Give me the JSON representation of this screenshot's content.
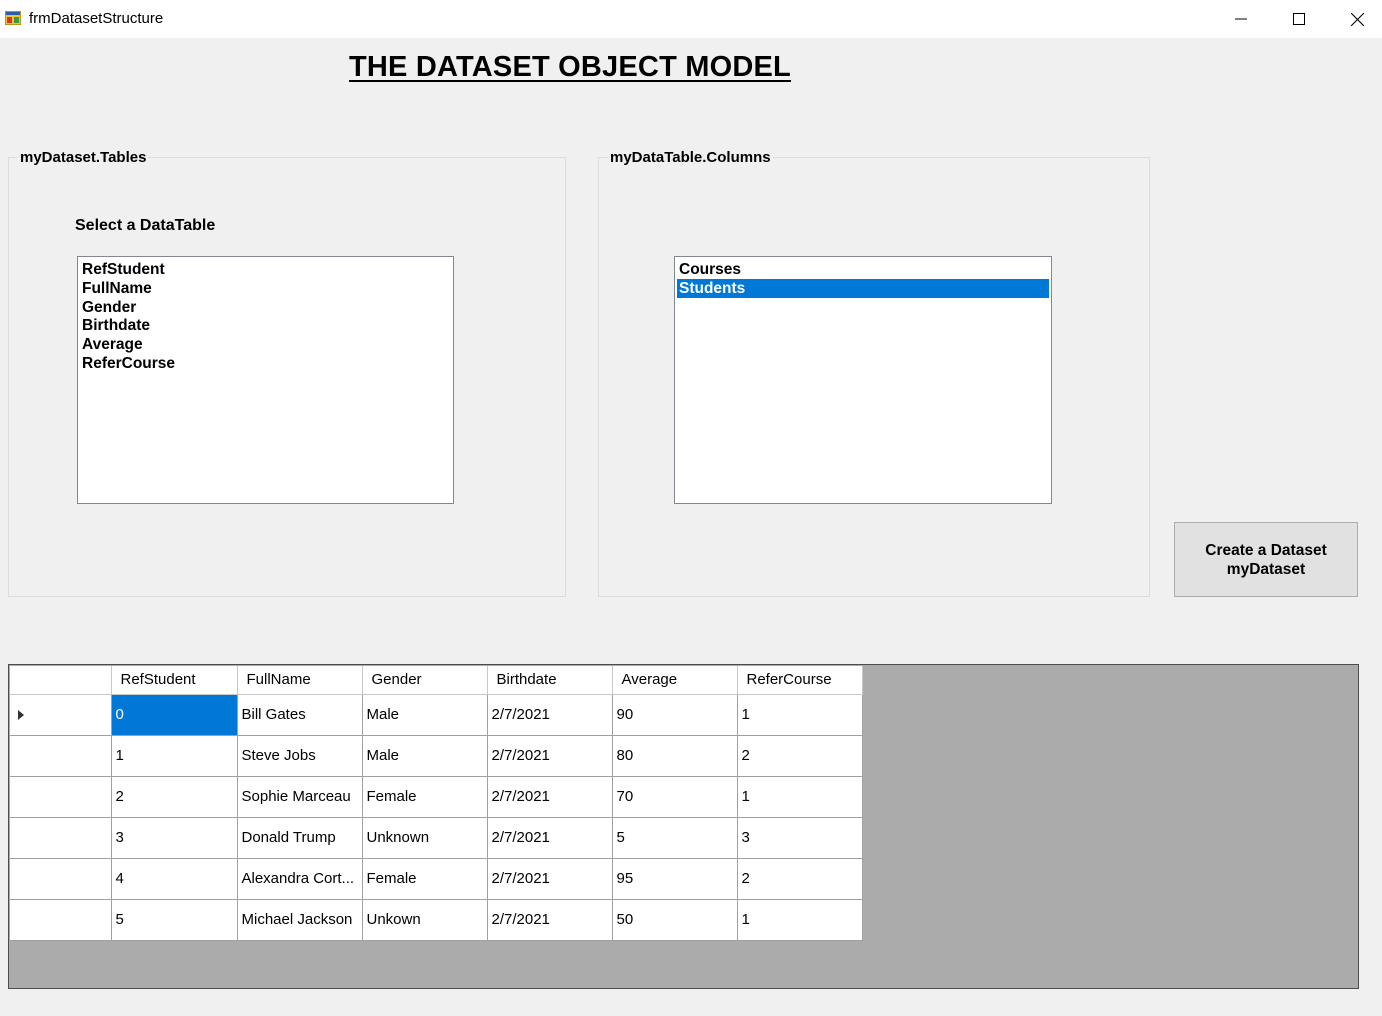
{
  "window": {
    "title": "frmDatasetStructure",
    "icon": "winforms-app-icon",
    "controls": [
      "minimize-icon",
      "maximize-icon",
      "close-icon"
    ]
  },
  "heading": "THE DATASET OBJECT MODEL",
  "tables_group": {
    "legend": "myDataset.Tables",
    "label": "Select a DataTable",
    "items": [
      "RefStudent",
      "FullName",
      "Gender",
      "Birthdate",
      "Average",
      "ReferCourse"
    ]
  },
  "columns_group": {
    "legend": "myDataTable.Columns",
    "items": [
      "Courses",
      "Students"
    ],
    "selected": "Students"
  },
  "create_button": {
    "line1": "Create a Dataset",
    "line2": "myDataset"
  },
  "grid": {
    "columns": [
      "RefStudent",
      "FullName",
      "Gender",
      "Birthdate",
      "Average",
      "ReferCourse"
    ],
    "rows": [
      [
        "0",
        "Bill Gates",
        "Male",
        "2/7/2021",
        "90",
        "1"
      ],
      [
        "1",
        "Steve Jobs",
        "Male",
        "2/7/2021",
        "80",
        "2"
      ],
      [
        "2",
        "Sophie Marceau",
        "Female",
        "2/7/2021",
        "70",
        "1"
      ],
      [
        "3",
        "Donald Trump",
        "Unknown",
        "2/7/2021",
        "5",
        "3"
      ],
      [
        "4",
        "Alexandra Cort...",
        "Female",
        "2/7/2021",
        "95",
        "2"
      ],
      [
        "5",
        "Michael Jackson",
        "Unkown",
        "2/7/2021",
        "50",
        "1"
      ]
    ],
    "current_row": 0
  },
  "colors": {
    "selection": "#0078d7",
    "form_background": "#f0f0f0",
    "grid_background": "#ababab"
  }
}
